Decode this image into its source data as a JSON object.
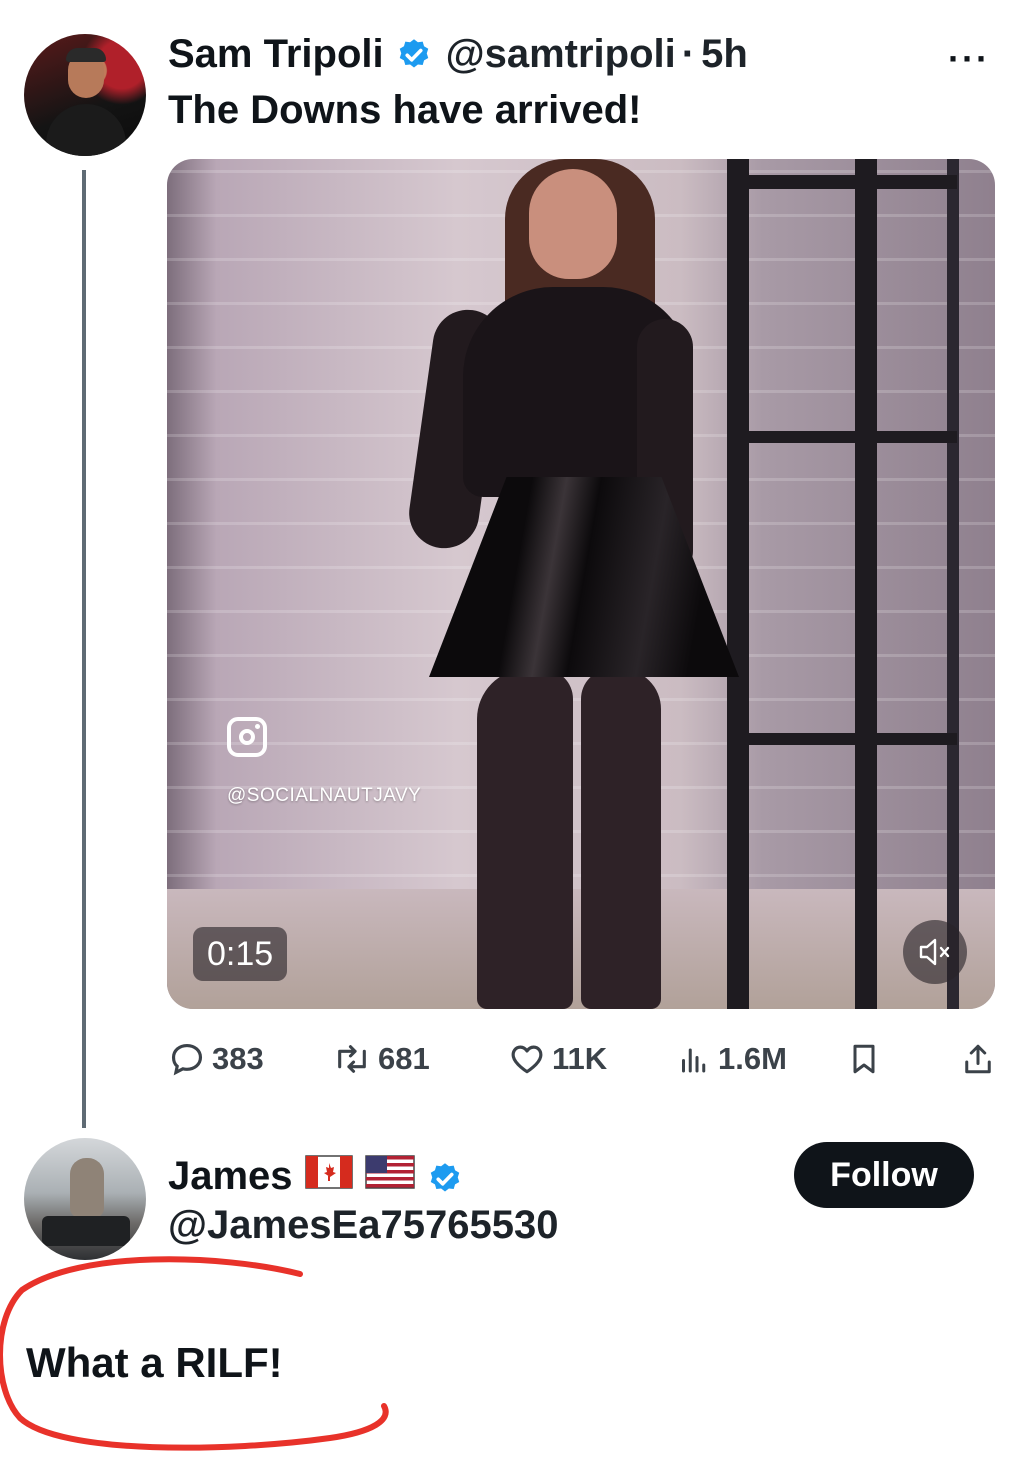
{
  "tweet": {
    "author_name": "Sam Tripoli",
    "handle": "@samtripoli",
    "separator": "·",
    "time": "5h",
    "more_label": "···",
    "text": "The Downs have arrived!",
    "media": {
      "instagram_tag": "@SOCIALNAUTJAVY",
      "timer": "0:15",
      "muted": true
    },
    "stats": {
      "replies": "383",
      "retweets": "681",
      "likes": "11K",
      "views": "1.6M"
    }
  },
  "reply": {
    "author_name": "James",
    "flags": [
      "canada-flag",
      "usa-flag"
    ],
    "handle": "@JamesEa75765530",
    "follow_label": "Follow",
    "text": "What a RILF!"
  },
  "colors": {
    "verified_blue": "#1d9bf0",
    "annotation_red": "#e8322a",
    "follow_bg": "#0f1419"
  }
}
